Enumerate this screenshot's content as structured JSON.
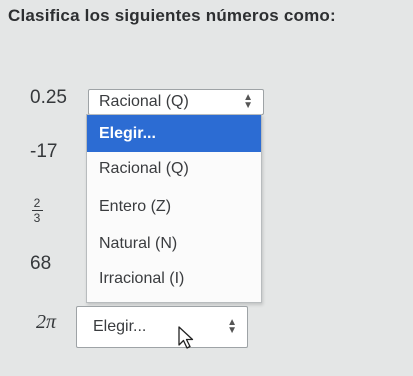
{
  "instruction": "Clasifica los siguientes números como:",
  "numbers": {
    "n0": "0.25",
    "n1": "-17",
    "n2_numerator": "2",
    "n2_denominator": "3",
    "n3": "68",
    "n4": "2π"
  },
  "selects": {
    "top_value": "Racional (Q)",
    "bottom_value": "Elegir..."
  },
  "dropdown": {
    "options": [
      "Elegir...",
      "Racional (Q)",
      "Entero (Z)",
      "Natural (N)",
      "Irracional (I)"
    ],
    "highlighted": "Elegir..."
  },
  "icons": {
    "select_arrows": "updown-arrows-icon",
    "pointer": "mouse-pointer-icon"
  },
  "colors": {
    "highlight": "#2c6cd3",
    "background": "#e4e6e6"
  }
}
